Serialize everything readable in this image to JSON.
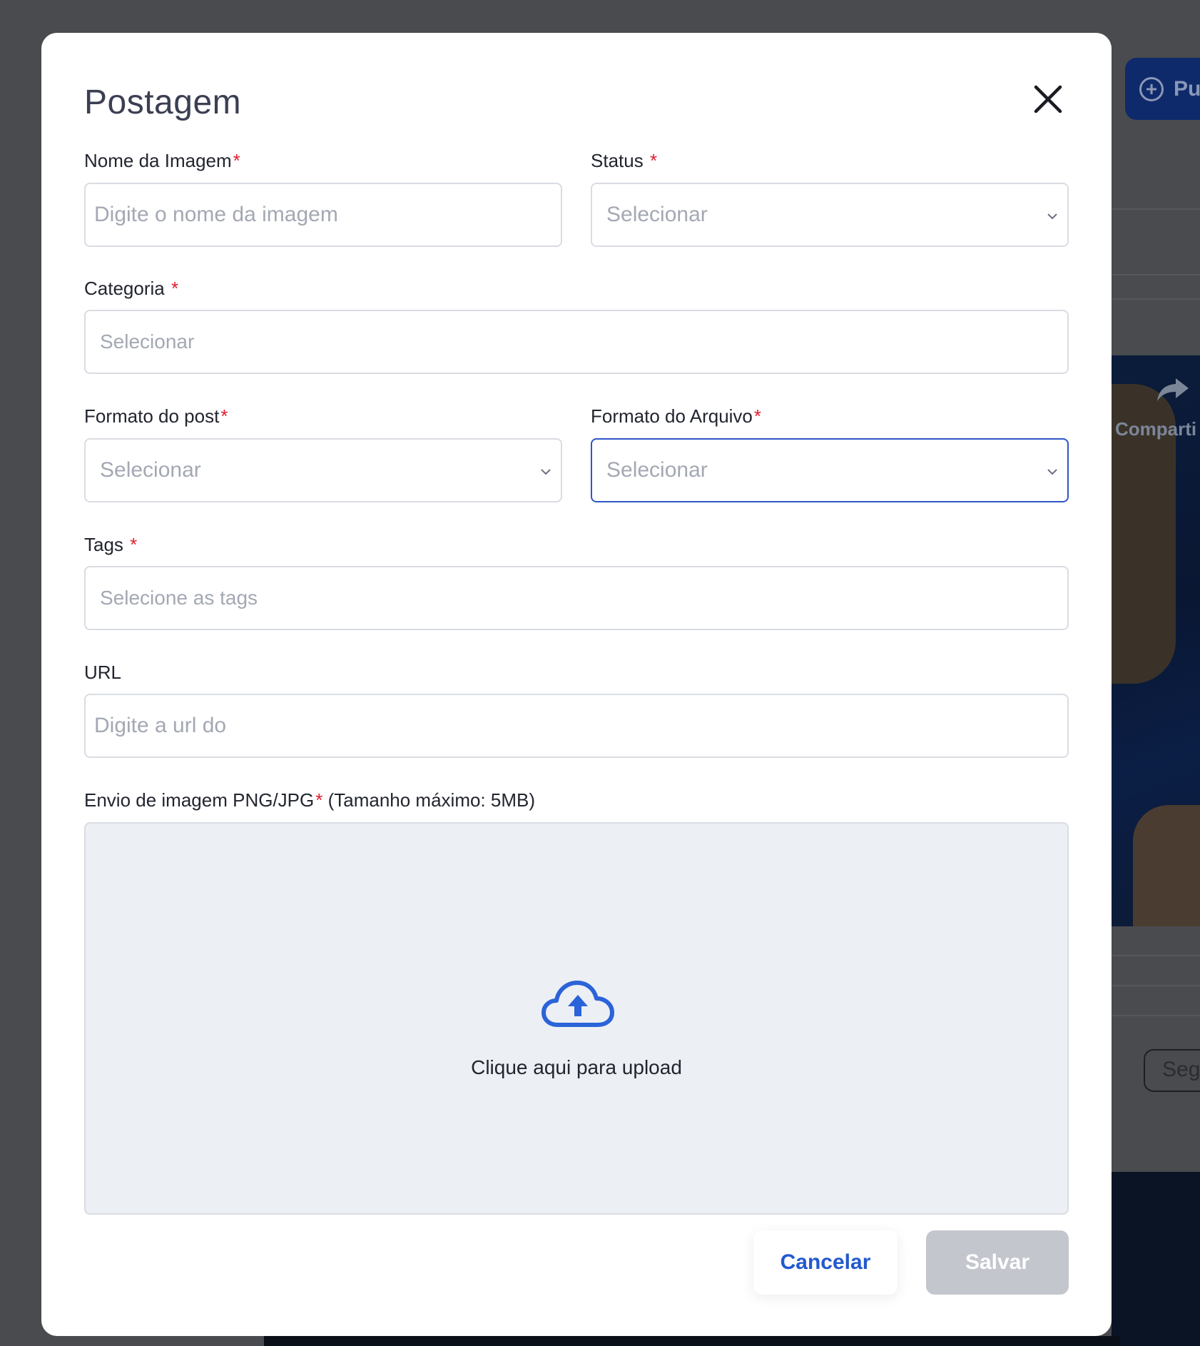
{
  "background": {
    "publish_button_label": "Pu",
    "share_label": "Comparti",
    "secondary_button_label": "Segu"
  },
  "modal": {
    "title": "Postagem",
    "fields": {
      "image_name": {
        "label": "Nome da Imagem",
        "required_mark": "*",
        "placeholder": "Digite o nome da imagem"
      },
      "status": {
        "label": "Status",
        "required_mark": "*",
        "placeholder": "Selecionar"
      },
      "category": {
        "label": "Categoria",
        "required_mark": "*",
        "placeholder": "Selecionar"
      },
      "post_format": {
        "label": "Formato do post",
        "required_mark": "*",
        "placeholder": "Selecionar"
      },
      "file_format": {
        "label": "Formato do Arquivo",
        "required_mark": "*",
        "placeholder": "Selecionar"
      },
      "tags": {
        "label": "Tags",
        "required_mark": "*",
        "placeholder": "Selecione as tags"
      },
      "url": {
        "label": "URL",
        "placeholder": "Digite a url do"
      }
    },
    "upload": {
      "label_prefix": "Envio de imagem PNG/JPG",
      "required_mark": "*",
      "label_suffix": " (Tamanho máximo: 5MB)",
      "cta": "Clique aqui para upload"
    },
    "buttons": {
      "cancel": "Cancelar",
      "save": "Salvar"
    }
  },
  "colors": {
    "accent": "#2359cf",
    "focus_border": "#2f55c8",
    "required": "#e11d2e",
    "save_disabled": "#c3c6cd",
    "overlay": "#4a4b4f"
  }
}
